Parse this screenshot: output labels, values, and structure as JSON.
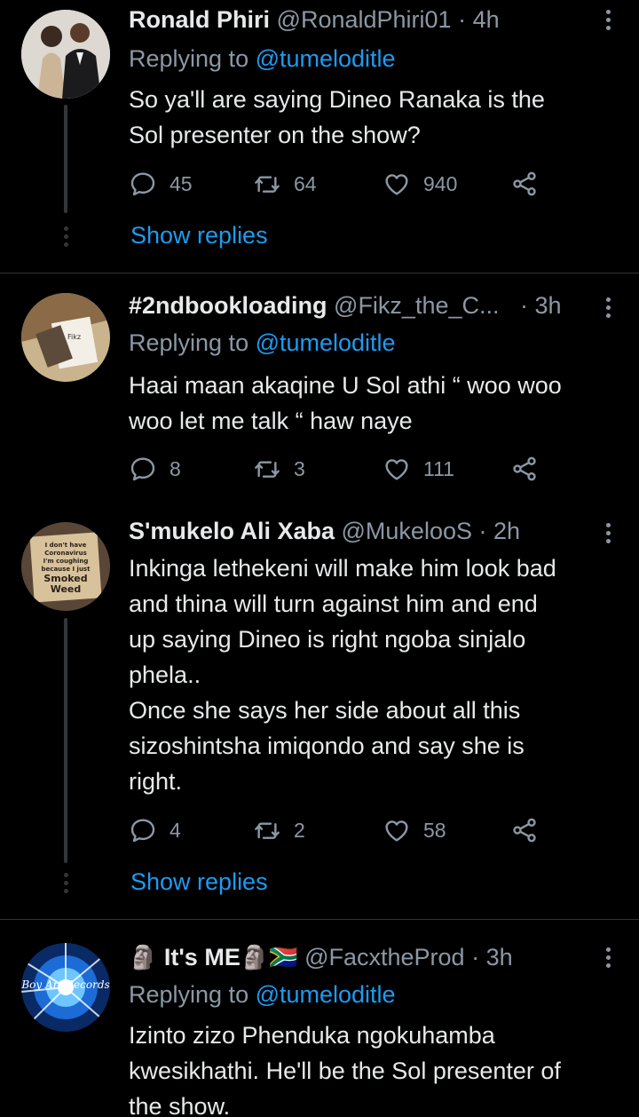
{
  "tweets": [
    {
      "name": "Ronald Phiri",
      "handle": "@RonaldPhiri01",
      "sep": "·",
      "time": "4h",
      "replying_prefix": "Replying to ",
      "replying_to": "@tumeloditle",
      "lines": [
        "So ya'll are saying Dineo Ranaka is the",
        "Sol presenter on the show?"
      ],
      "replies": "45",
      "retweets": "64",
      "likes": "940",
      "show_replies": "Show replies"
    },
    {
      "name": "#2ndbookloading",
      "handle": "@Fikz_the_C...",
      "sep": "·",
      "time": "3h",
      "replying_prefix": "Replying to ",
      "replying_to": "@tumeloditle",
      "lines": [
        "Haai maan akaqine U Sol athi “ woo woo",
        "woo let me talk “ haw naye"
      ],
      "replies": "8",
      "retweets": "3",
      "likes": "111"
    },
    {
      "name": "S'mukelo Ali Xaba",
      "handle": "@MukelooS",
      "sep": "·",
      "time": "2h",
      "avatar_sign": [
        "I don't have",
        "Coronavirus",
        "I'm coughing",
        "because I just",
        "Smoked",
        "Weed"
      ],
      "lines": [
        "Inkinga lethekeni will make him look bad",
        "and thina will turn against him and end",
        "up saying Dineo is right ngoba sinjalo",
        "phela..",
        "Once she says her side about all this",
        "sizoshintsha imiqondo and say she is",
        "right."
      ],
      "replies": "4",
      "retweets": "2",
      "likes": "58",
      "show_replies": "Show replies"
    },
    {
      "name": "It's ME",
      "name_emoji_left": "🗿",
      "name_emoji_right": "🗿🇿🇦",
      "handle": "@FacxtheProd",
      "sep": "·",
      "time": "3h",
      "avatar_text": "Boy Art Records",
      "replying_prefix": "Replying to ",
      "replying_to": "@tumeloditle",
      "lines": [
        "Izinto zizo Phenduka ngokuhamba",
        "kwesikhathi. He'll be the Sol presenter of",
        "the show."
      ]
    }
  ],
  "icons": {
    "reply": "reply-icon",
    "retweet": "retweet-icon",
    "like": "heart-icon",
    "share": "share-icon",
    "more": "more-vertical-icon"
  },
  "colors": {
    "background": "#000000",
    "text": "#e7e9ea",
    "muted": "#8b98a5",
    "accent": "#1d9bf0",
    "divider": "#2f3336"
  }
}
